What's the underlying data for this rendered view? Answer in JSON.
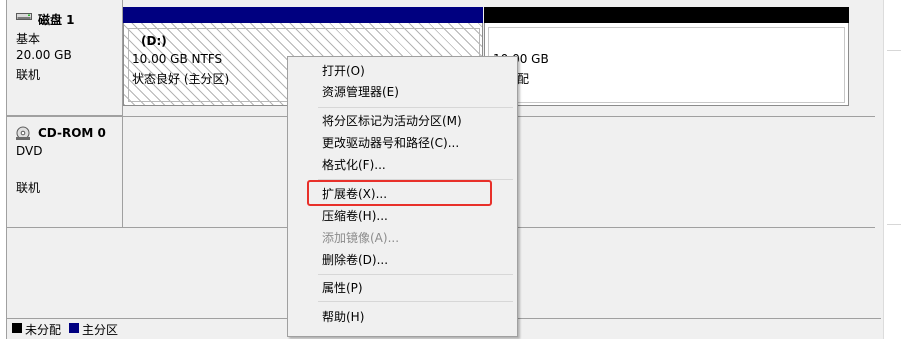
{
  "disks": [
    {
      "name": "磁盘 1",
      "type": "基本",
      "size": "20.00 GB",
      "status": "联机",
      "icon": "hard-disk-icon"
    },
    {
      "name": "CD-ROM 0",
      "type": "DVD",
      "status": "联机",
      "icon": "cdrom-icon"
    }
  ],
  "partitions": {
    "d": {
      "label": "(D:)",
      "size_fs": "10.00 GB NTFS",
      "status": "状态良好 (主分区)",
      "color": "#000080"
    },
    "unallocated": {
      "size": "10.00 GB",
      "status": "未分配",
      "color": "#000000"
    }
  },
  "context_menu": {
    "items": [
      {
        "label": "打开(O)",
        "enabled": true
      },
      {
        "label": "资源管理器(E)",
        "enabled": true
      },
      {
        "label": "将分区标记为活动分区(M)",
        "enabled": true
      },
      {
        "label": "更改驱动器号和路径(C)...",
        "enabled": true
      },
      {
        "label": "格式化(F)...",
        "enabled": true
      },
      {
        "label": "扩展卷(X)...",
        "enabled": true,
        "highlighted": true
      },
      {
        "label": "压缩卷(H)...",
        "enabled": true
      },
      {
        "label": "添加镜像(A)...",
        "enabled": false
      },
      {
        "label": "删除卷(D)...",
        "enabled": true
      },
      {
        "label": "属性(P)",
        "enabled": true
      },
      {
        "label": "帮助(H)",
        "enabled": true
      }
    ]
  },
  "legend": [
    {
      "label": "未分配",
      "color": "#000000"
    },
    {
      "label": "主分区",
      "color": "#000080"
    }
  ],
  "colors": {
    "highlight_border": "#e8302a",
    "primary_partition": "#000080",
    "unallocated": "#000000"
  }
}
